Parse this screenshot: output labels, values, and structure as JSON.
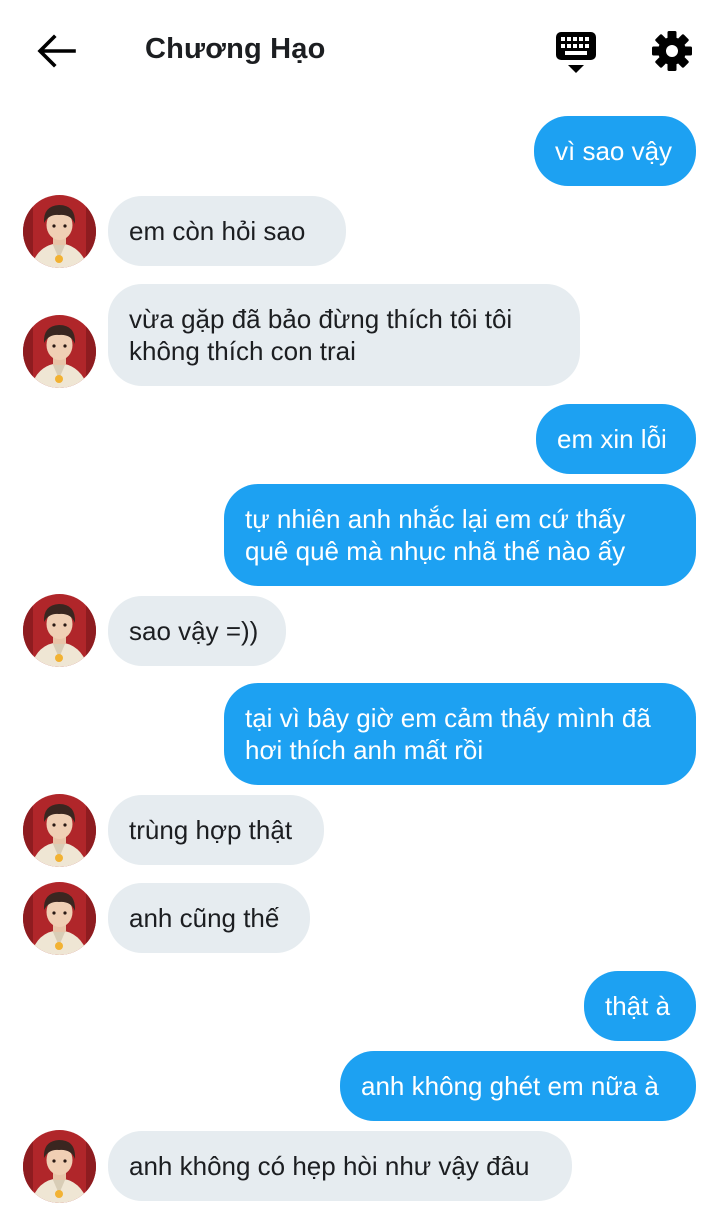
{
  "header": {
    "contact_name": "Chương Hạo",
    "back_icon": "arrow-left-icon",
    "keyboard_icon": "keyboard-icon",
    "settings_icon": "gear-icon"
  },
  "colors": {
    "sent_bubble": "#1da1f2",
    "received_bubble": "#e6ecf0",
    "text_dark": "#1c1e21"
  },
  "messages": [
    {
      "from": "me",
      "text": "vì sao vậy"
    },
    {
      "from": "them",
      "text": "em còn hỏi sao"
    },
    {
      "from": "them",
      "text": "vừa gặp đã bảo đừng thích tôi tôi\nkhông thích con trai"
    },
    {
      "from": "me",
      "text": "em xin lỗi"
    },
    {
      "from": "me",
      "text": "tự nhiên anh nhắc lại em cứ thấy\nquê quê mà nhục nhã thế nào ấy"
    },
    {
      "from": "them",
      "text": "sao vậy =))"
    },
    {
      "from": "me",
      "text": "tại vì bây giờ em cảm thấy mình đã\nhơi thích anh mất rồi"
    },
    {
      "from": "them",
      "text": "trùng hợp thật"
    },
    {
      "from": "them",
      "text": "anh cũng thế"
    },
    {
      "from": "me",
      "text": "thật à"
    },
    {
      "from": "me",
      "text": "anh không ghét em nữa à"
    },
    {
      "from": "them",
      "text": "anh không có hẹp hòi như vậy đâu"
    }
  ]
}
